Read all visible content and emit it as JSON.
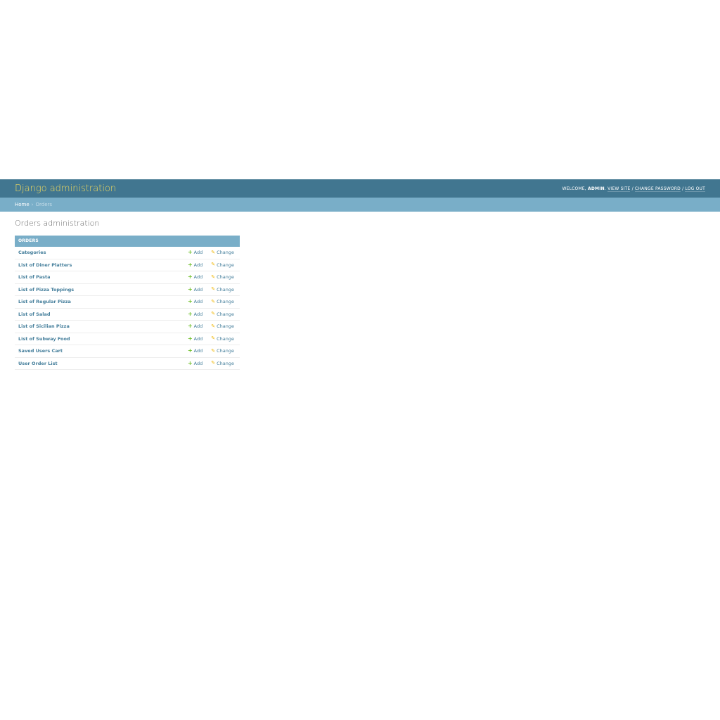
{
  "header": {
    "branding": "Django administration",
    "welcome_text": "Welcome,",
    "user_name": "admin",
    "view_site": "View site",
    "change_password": "Change password",
    "log_out": "Log out",
    "separator": "/"
  },
  "breadcrumbs": {
    "home": "Home",
    "separator": "›",
    "current": "Orders"
  },
  "content": {
    "title": "Orders administration"
  },
  "module": {
    "caption": "Orders",
    "add_label": "Add",
    "change_label": "Change",
    "models": [
      "Categories",
      "List of Diner Platters",
      "List of Pasta",
      "List of Pizza Toppings",
      "List of Regular Pizza",
      "List of Salad",
      "List of Sicilian Pizza",
      "List of Subway Food",
      "Saved Users Cart",
      "User Order List"
    ]
  },
  "colors": {
    "header_bg": "#417690",
    "branding": "#f5dd5d",
    "breadcrumbs_bg": "#79aec8",
    "link": "#447e9b",
    "add_icon": "#70bf2b",
    "change_icon": "#efb80b"
  },
  "icons": {
    "add": "plus-icon",
    "change": "pencil-icon"
  }
}
